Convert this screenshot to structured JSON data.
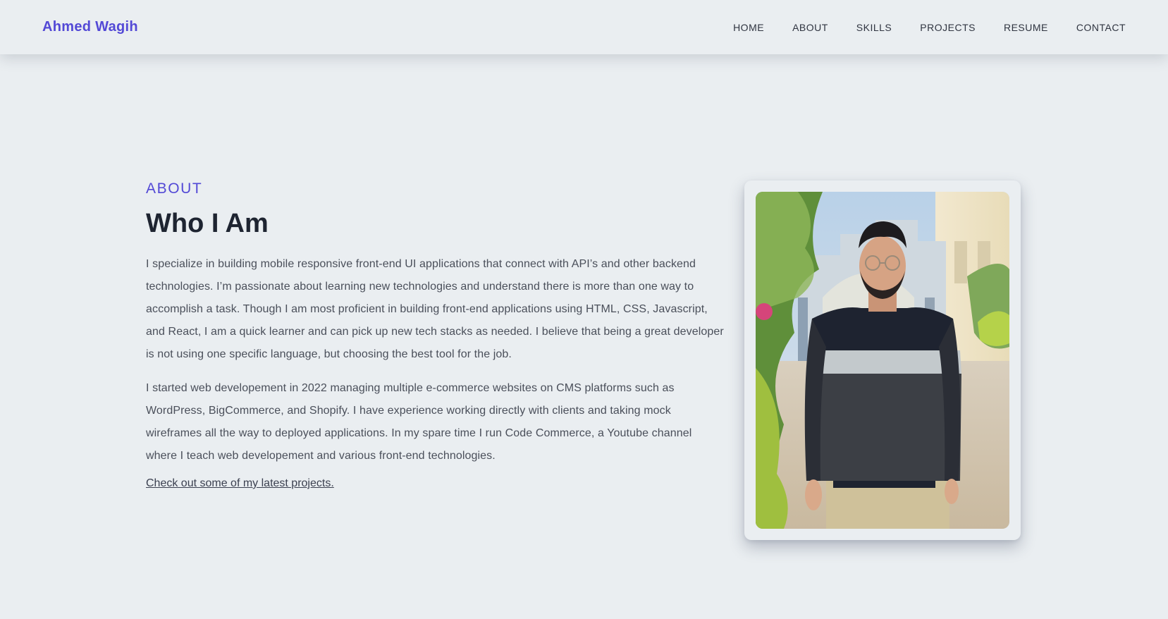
{
  "header": {
    "brand": "Ahmed Wagih",
    "nav": [
      "HOME",
      "ABOUT",
      "SKILLS",
      "PROJECTS",
      "RESUME",
      "CONTACT"
    ]
  },
  "about": {
    "eyebrow": "ABOUT",
    "title": "Who I Am",
    "paragraph_1": "I specialize in building mobile responsive front-end UI applications that connect with API’s and other backend technologies. I’m passionate about learning new technologies and understand there is more than one way to accomplish a task. Though I am most proficient in building front-end applications using HTML, CSS, Javascript, and React, I am a quick learner and can pick up new tech stacks as needed. I believe that being a great developer is not using one specific language, but choosing the best tool for the job.",
    "paragraph_2": "I started web developement in 2022 managing multiple e-commerce websites on CMS platforms such as WordPress, BigCommerce, and Shopify. I have experience working directly with clients and taking mock wireframes all the way to deployed applications. In my spare time I run Code Commerce, a Youtube channel where I teach web developement and various front-end technologies.",
    "projects_link": "Check out some of my latest projects."
  },
  "colors": {
    "accent": "#5349d6",
    "background": "#eaeef1",
    "heading": "#1e2431",
    "body_text": "#4a4f5a"
  }
}
